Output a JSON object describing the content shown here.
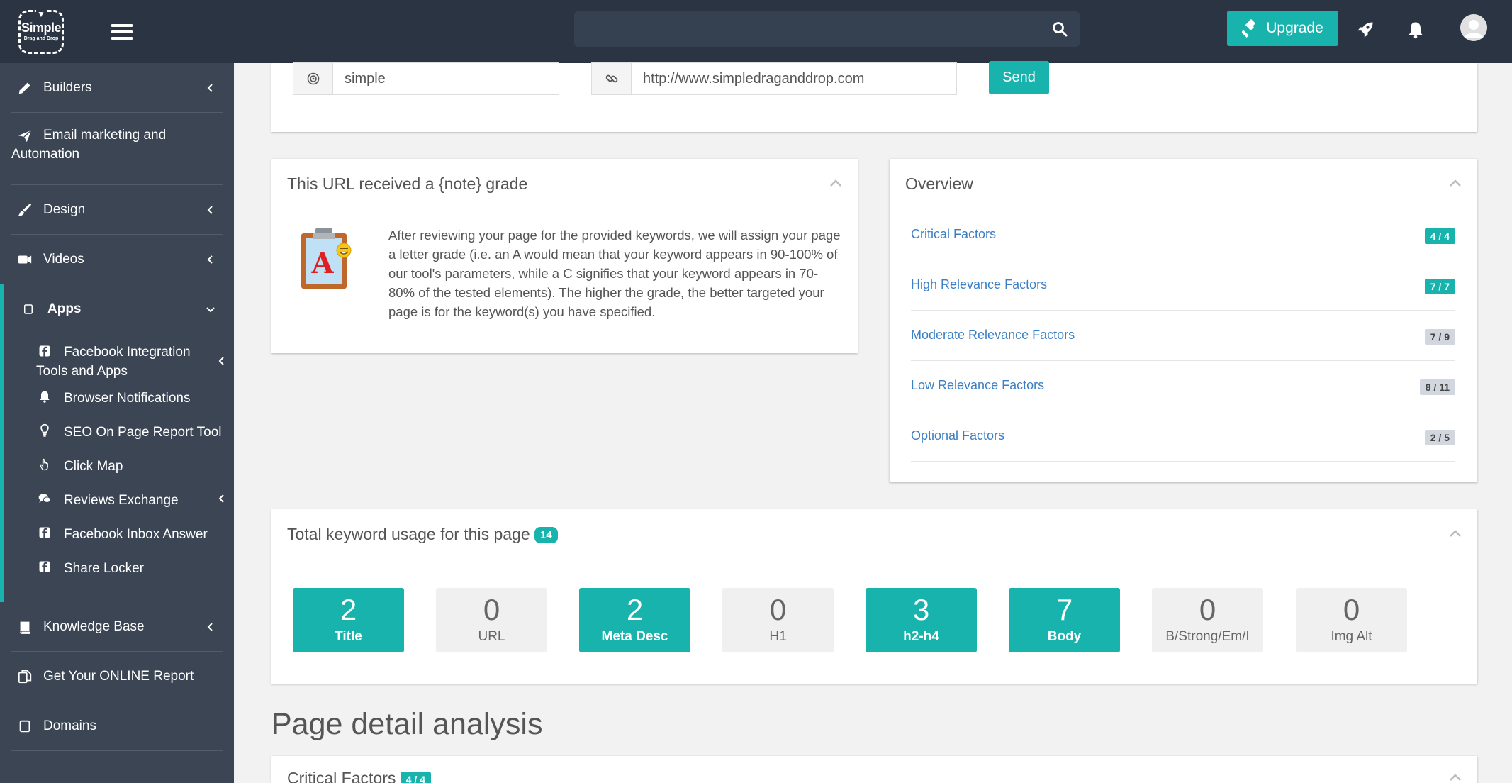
{
  "logo": {
    "line1": "Simple",
    "line2": "Drag and Drop"
  },
  "search": {
    "value": ""
  },
  "header": {
    "upgrade_label": "Upgrade"
  },
  "sidebar": {
    "items_top": [
      {
        "label": "Builders",
        "icon": "pencil-icon"
      },
      {
        "label": "Email marketing and Automation",
        "icon": "paper-plane-icon"
      },
      {
        "label": "Design",
        "icon": "brush-icon"
      },
      {
        "label": "Videos",
        "icon": "video-camera-icon"
      }
    ],
    "apps": {
      "label": "Apps",
      "subitems": [
        {
          "label": "Facebook Integration Tools and Apps",
          "icon": "facebook-icon"
        },
        {
          "label": "Browser Notifications",
          "icon": "bell-icon"
        },
        {
          "label": "SEO On Page Report Tool",
          "icon": "lightbulb-icon"
        },
        {
          "label": "Click Map",
          "icon": "hand-pointer-icon"
        },
        {
          "label": "Reviews Exchange",
          "icon": "comments-icon"
        },
        {
          "label": "Facebook Inbox Answer",
          "icon": "facebook-icon"
        },
        {
          "label": "Share Locker",
          "icon": "facebook-icon"
        }
      ]
    },
    "items_bottom": [
      {
        "label": "Knowledge Base",
        "icon": "book-icon"
      },
      {
        "label": "Get Your ONLINE Report",
        "icon": "copy-icon"
      },
      {
        "label": "Domains",
        "icon": "square-icon"
      }
    ]
  },
  "form": {
    "keyword_value": "simple",
    "url_value": "http://www.simpledraganddrop.com",
    "send_label": "Send"
  },
  "grade": {
    "title": "This URL received a {note} grade",
    "icon_letter": "A",
    "text": "After reviewing your page for the provided keywords, we will assign your page a letter grade (i.e. an A would mean that your keyword appears in 90-100% of our tool's parameters, while a C signifies that your keyword appears in 70-80% of the tested elements). The higher the grade, the better targeted your page is for the keyword(s) you have specified."
  },
  "overview": {
    "title": "Overview",
    "rows": [
      {
        "label": "Critical Factors",
        "count": "4 / 4",
        "complete": true
      },
      {
        "label": "High Relevance Factors",
        "count": "7 / 7",
        "complete": true
      },
      {
        "label": "Moderate Relevance Factors",
        "count": "7 / 9",
        "complete": false
      },
      {
        "label": "Low Relevance Factors",
        "count": "8 / 11",
        "complete": false
      },
      {
        "label": "Optional Factors",
        "count": "2 / 5",
        "complete": false
      }
    ]
  },
  "keyword_usage": {
    "title": "Total keyword usage for this page",
    "total": "14",
    "boxes": [
      {
        "value": "2",
        "label": "Title",
        "active": true
      },
      {
        "value": "0",
        "label": "URL",
        "active": false
      },
      {
        "value": "2",
        "label": "Meta Desc",
        "active": true
      },
      {
        "value": "0",
        "label": "H1",
        "active": false
      },
      {
        "value": "3",
        "label": "h2-h4",
        "active": true
      },
      {
        "value": "7",
        "label": "Body",
        "active": true
      },
      {
        "value": "0",
        "label": "B/Strong/Em/I",
        "active": false
      },
      {
        "value": "0",
        "label": "Img Alt",
        "active": false
      }
    ]
  },
  "detail": {
    "title": "Page detail analysis",
    "first_section": "Critical Factors",
    "first_section_badge": "4 / 4"
  },
  "colors": {
    "accent": "#17b3ac",
    "topbar": "#2b3442",
    "sidebar": "#3b4554",
    "link": "#3b7fc4"
  }
}
